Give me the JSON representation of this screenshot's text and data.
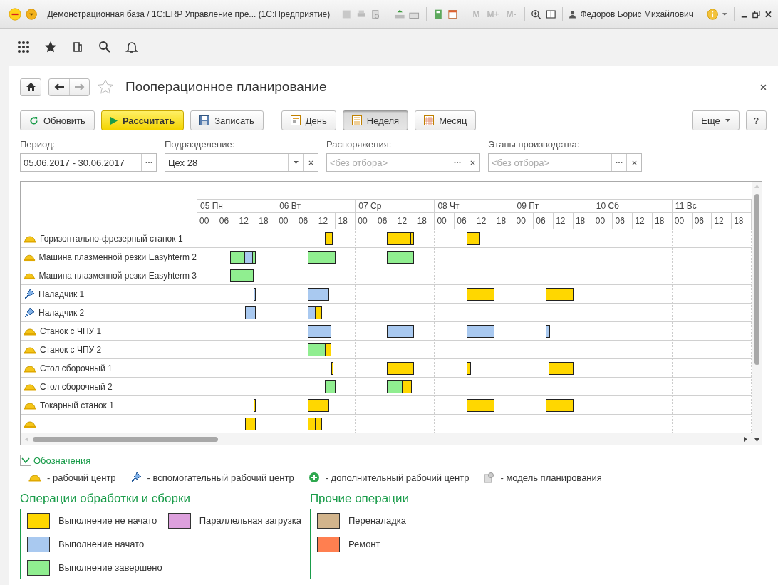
{
  "window": {
    "title": "Демонстрационная база / 1С:ERP Управление пре...  (1С:Предприятие)",
    "memory_buttons": [
      "M",
      "M+",
      "M-"
    ],
    "user": "Федоров Борис Михайлович"
  },
  "page": {
    "title": "Пооперационное планирование"
  },
  "toolbar": {
    "buttons": [
      {
        "label": "Обновить",
        "kind": "refresh"
      },
      {
        "label": "Рассчитать",
        "kind": "calculate"
      },
      {
        "label": "Записать",
        "kind": "save"
      }
    ],
    "scale": [
      {
        "label": "День",
        "selected": false
      },
      {
        "label": "Неделя",
        "selected": true
      },
      {
        "label": "Месяц",
        "selected": false
      }
    ],
    "more": "Еще",
    "help": "?"
  },
  "filters": [
    {
      "label": "Период:",
      "value": "05.06.2017 - 30.06.2017",
      "kind": "period"
    },
    {
      "label": "Подразделение:",
      "value": "Цех 28",
      "kind": "select"
    },
    {
      "label": "Распоряжения:",
      "placeholder": "<без отбора>",
      "kind": "choice"
    },
    {
      "label": "Этапы производства:",
      "placeholder": "<без отбора>",
      "kind": "choice"
    }
  ],
  "gantt": {
    "days": [
      {
        "label": "05 Пн",
        "hours": [
          "00",
          "06",
          "12",
          "18"
        ]
      },
      {
        "label": "06 Вт",
        "hours": [
          "00",
          "06",
          "12",
          "18"
        ]
      },
      {
        "label": "07 Ср",
        "hours": [
          "00",
          "06",
          "12",
          "18"
        ]
      },
      {
        "label": "08 Чт",
        "hours": [
          "00",
          "06",
          "12",
          "18"
        ]
      },
      {
        "label": "09 Пт",
        "hours": [
          "00",
          "06",
          "12",
          "18"
        ]
      },
      {
        "label": "10 Сб",
        "hours": [
          "00",
          "06",
          "12",
          "18"
        ]
      },
      {
        "label": "11 Вс",
        "hours": [
          "00",
          "06",
          "12",
          "18"
        ]
      }
    ],
    "rows": [
      {
        "name": "Горизонтально-фрезерный станок 1",
        "kind": "work_center",
        "bars": [
          [
            {
              "color": "#ffd700"
            }
          ],
          [
            {
              "color": "#ffd700"
            },
            {
              "color": "#ffd700"
            }
          ],
          [
            {
              "color": "#ffd700"
            }
          ]
        ]
      },
      {
        "name": "Машина плазменной резки Easyhterm 2",
        "kind": "work_center",
        "bars": [
          [
            {
              "color": "#90ee90"
            },
            {
              "color": "#a9c9f0"
            },
            {
              "color": "#90ee90"
            }
          ],
          [
            {
              "color": "#90ee90"
            }
          ],
          [
            {
              "color": "#90ee90"
            }
          ]
        ]
      },
      {
        "name": "Машина плазменной резки Easyhterm 3",
        "kind": "work_center",
        "bars": [
          [
            {
              "color": "#90ee90"
            }
          ]
        ]
      },
      {
        "name": "Наладчик 1",
        "kind": "auxiliary",
        "bars": [
          [
            {
              "color": "#a9c9f0"
            }
          ],
          [
            {
              "color": "#a9c9f0"
            }
          ],
          [
            {
              "color": "#ffd700"
            }
          ],
          [
            {
              "color": "#ffd700"
            }
          ]
        ]
      },
      {
        "name": "Наладчик 2",
        "kind": "auxiliary",
        "bars": [
          [
            {
              "color": "#a9c9f0"
            }
          ],
          [
            {
              "color": "#a9c9f0"
            },
            {
              "color": "#ffd700"
            }
          ]
        ]
      },
      {
        "name": "Станок с ЧПУ 1",
        "kind": "work_center",
        "bars": [
          [
            {
              "color": "#a9c9f0"
            }
          ],
          [
            {
              "color": "#a9c9f0"
            }
          ],
          [
            {
              "color": "#a9c9f0"
            }
          ],
          [
            {
              "color": "#a9c9f0"
            }
          ]
        ]
      },
      {
        "name": "Станок с ЧПУ 2",
        "kind": "work_center",
        "bars": [
          [
            {
              "color": "#90ee90"
            },
            {
              "color": "#ffd700"
            }
          ]
        ]
      },
      {
        "name": "Стол сборочный 1",
        "kind": "work_center",
        "bars": [
          [
            {
              "color": "#ffd700"
            }
          ],
          [
            {
              "color": "#ffd700"
            }
          ],
          [
            {
              "color": "#ffd700"
            }
          ],
          [
            {
              "color": "#ffd700"
            }
          ]
        ]
      },
      {
        "name": "Стол сборочный 2",
        "kind": "work_center",
        "bars": [
          [
            {
              "color": "#90ee90"
            }
          ],
          [
            {
              "color": "#90ee90"
            },
            {
              "color": "#ffd700"
            }
          ]
        ]
      },
      {
        "name": "Токарный станок 1",
        "kind": "work_center",
        "bars": [
          [
            {
              "color": "#ffd700"
            }
          ],
          [
            {
              "color": "#ffd700"
            }
          ],
          [
            {
              "color": "#ffd700"
            }
          ],
          [
            {
              "color": "#ffd700"
            }
          ]
        ]
      },
      {
        "kind": "work_center",
        "bars": [
          [
            {
              "color": "#ffd700"
            }
          ],
          [
            {
              "color": "#ffd700"
            },
            {
              "color": "#ffd700"
            }
          ]
        ]
      }
    ]
  },
  "legend": {
    "title": "Обозначения",
    "expanded": true,
    "icons": [
      {
        "kind": "work_center",
        "label": "- рабочий центр"
      },
      {
        "kind": "auxiliary",
        "label": "- вспомогательный рабочий центр"
      },
      {
        "kind": "additional",
        "label": "- дополнительный рабочий центр"
      },
      {
        "kind": "planning_model",
        "label": "- модель планирования"
      }
    ],
    "groups": [
      {
        "title": "Операции обработки и сборки",
        "items": [
          {
            "label": "Выполнение не начато",
            "color": "#ffd700"
          },
          {
            "label": "Выполнение начато",
            "color": "#a9c9f0"
          },
          {
            "label": "Выполнение завершено",
            "color": "#90ee90"
          },
          {
            "label": "Параллельная загрузка",
            "color": "#dda0dd"
          }
        ]
      },
      {
        "title": "Прочие операции",
        "items": [
          {
            "label": "Переналадка",
            "color": "#d2b48c"
          },
          {
            "label": "Ремонт",
            "color": "#ff7f50"
          }
        ]
      }
    ]
  }
}
